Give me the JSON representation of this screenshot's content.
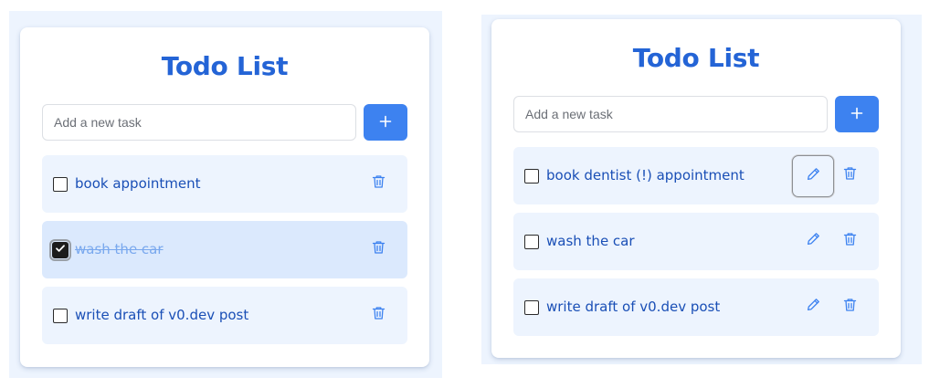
{
  "left_app": {
    "title": "Todo List",
    "input": {
      "placeholder": "Add a new task",
      "value": ""
    },
    "add_button_label": "+",
    "todos": [
      {
        "text": "book appointment",
        "completed": false
      },
      {
        "text": "wash the car",
        "completed": true
      },
      {
        "text": "write draft of v0.dev post",
        "completed": false
      }
    ]
  },
  "right_app": {
    "title": "Todo List",
    "input": {
      "placeholder": "Add a new task",
      "value": ""
    },
    "add_button_label": "+",
    "todos": [
      {
        "text": "book dentist (!) appointment",
        "completed": false,
        "edit_focused": true
      },
      {
        "text": "wash the car",
        "completed": false
      },
      {
        "text": "write draft of v0.dev post",
        "completed": false
      }
    ]
  },
  "colors": {
    "accent": "#3d82f0",
    "title": "#2464d6",
    "item_bg": "#edf4fe",
    "item_done_bg": "#dbe9fd",
    "item_text": "#1a4fb6",
    "done_text": "#79a8ee"
  },
  "icons": {
    "add": "plus-icon",
    "delete": "trash-icon",
    "edit": "pencil-icon",
    "check": "checkmark-icon"
  }
}
